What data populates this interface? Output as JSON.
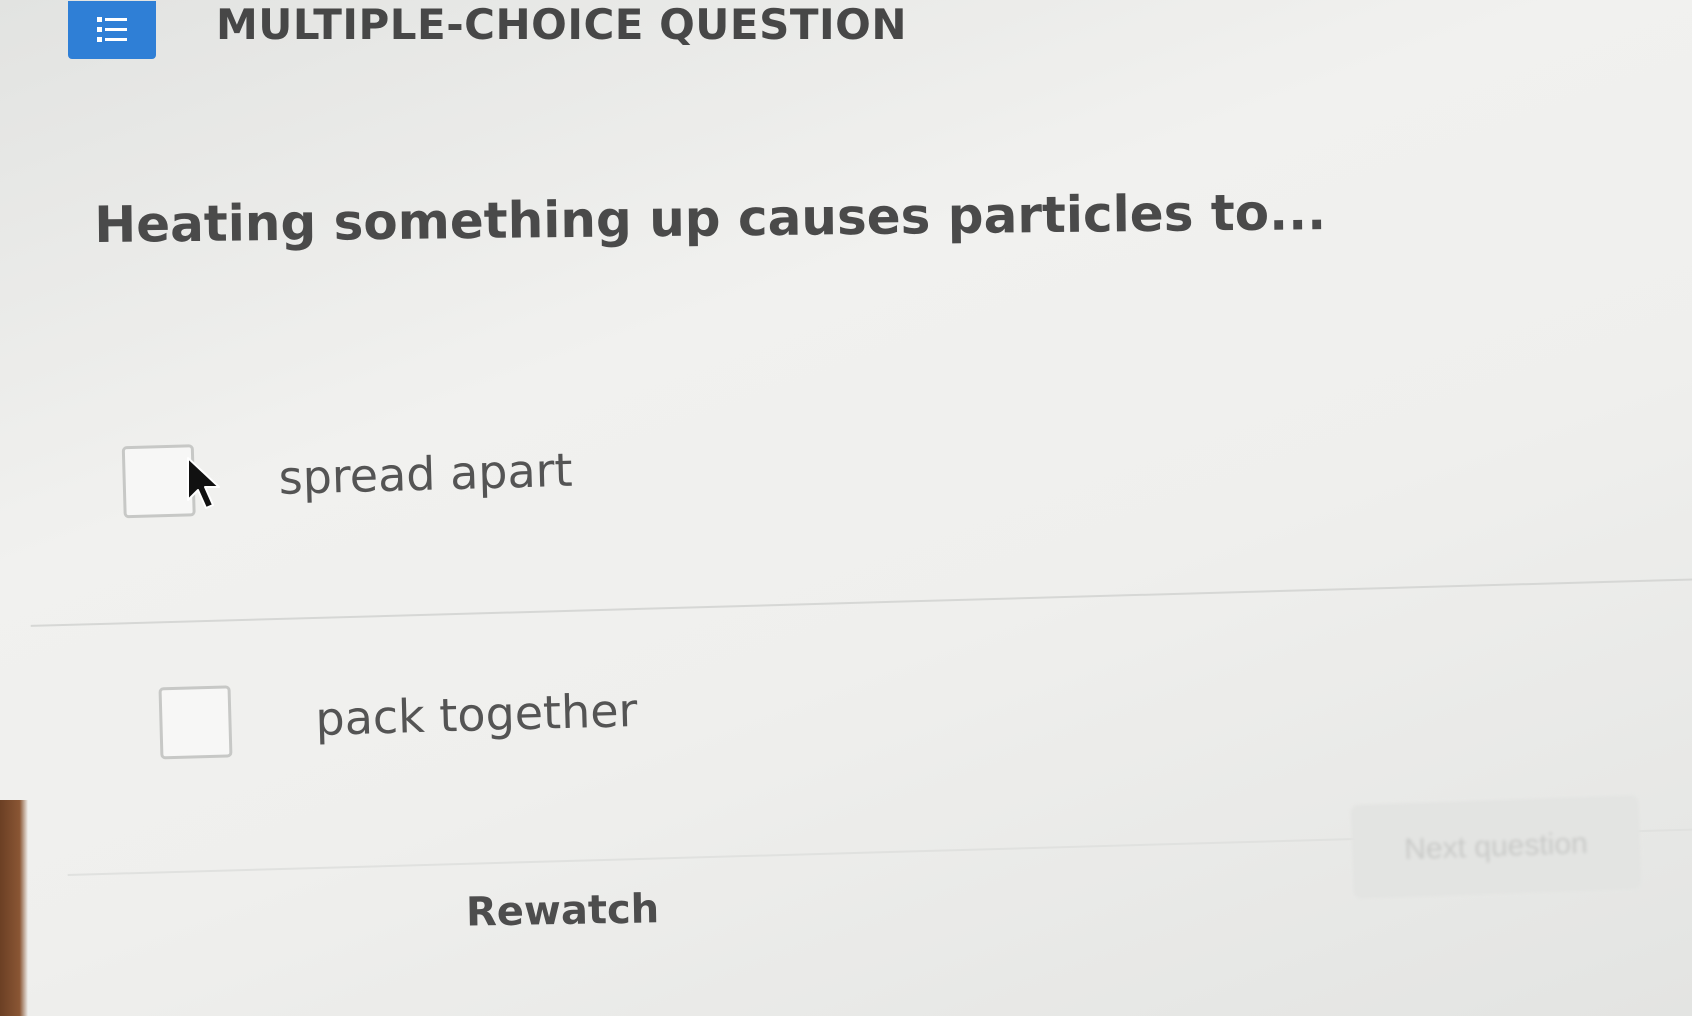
{
  "header": {
    "type_icon": "list-icon",
    "label": "MULTIPLE-CHOICE QUESTION"
  },
  "question": {
    "text": "Heating something up causes particles to..."
  },
  "options": [
    {
      "label": "spread apart",
      "checked": false
    },
    {
      "label": "pack together",
      "checked": false
    }
  ],
  "footer": {
    "rewatch_label": "Rewatch",
    "next_label": "Next question"
  },
  "colors": {
    "accent": "#2f7fd6",
    "text": "#474747",
    "background": "#efefed"
  }
}
